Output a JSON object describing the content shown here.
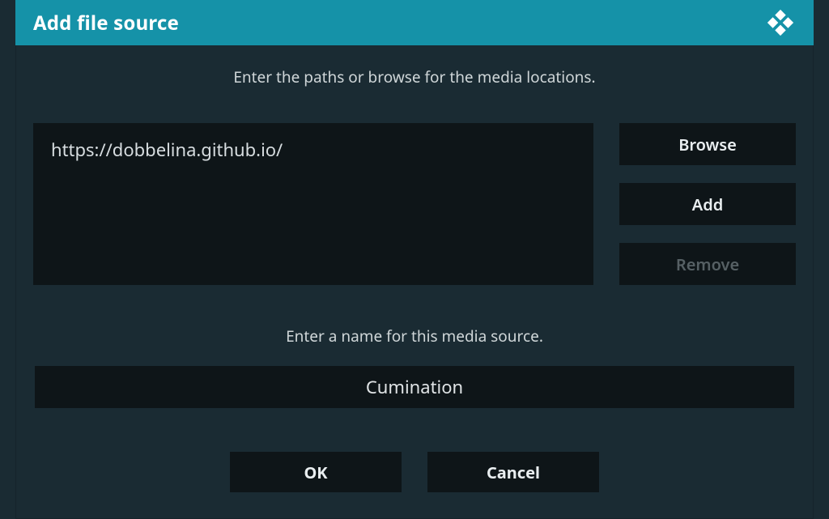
{
  "dialog": {
    "title": "Add file source",
    "paths_instruction": "Enter the paths or browse for the media locations.",
    "name_instruction": "Enter a name for this media source.",
    "path_value": "https://dobbelina.github.io/",
    "source_name": "Cumination",
    "buttons": {
      "browse": "Browse",
      "add": "Add",
      "remove": "Remove",
      "ok": "OK",
      "cancel": "Cancel"
    }
  }
}
